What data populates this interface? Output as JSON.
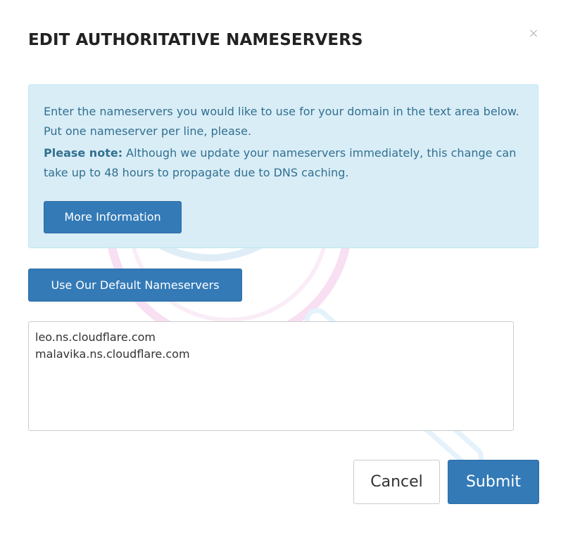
{
  "modal": {
    "title": "EDIT AUTHORITATIVE NAMESERVERS",
    "close_label": "×"
  },
  "info": {
    "paragraph1": "Enter the nameservers you would like to use for your domain in the text area below. Put one nameserver per line, please.",
    "note_label": "Please note:",
    "note_text": " Although we update your nameservers immediately, this change can take up to 48 hours to propagate due to DNS caching.",
    "more_info_label": "More Information"
  },
  "default_ns_label": "Use Our Default Nameservers",
  "nameservers": {
    "line1": "leo.ns.cloudflare.com",
    "line2": "malavika.ns.cloudflare.com"
  },
  "footer": {
    "cancel_label": "Cancel",
    "submit_label": "Submit"
  },
  "colors": {
    "primary": "#337ab7",
    "info_bg": "#d9edf7",
    "info_text": "#31708f"
  }
}
